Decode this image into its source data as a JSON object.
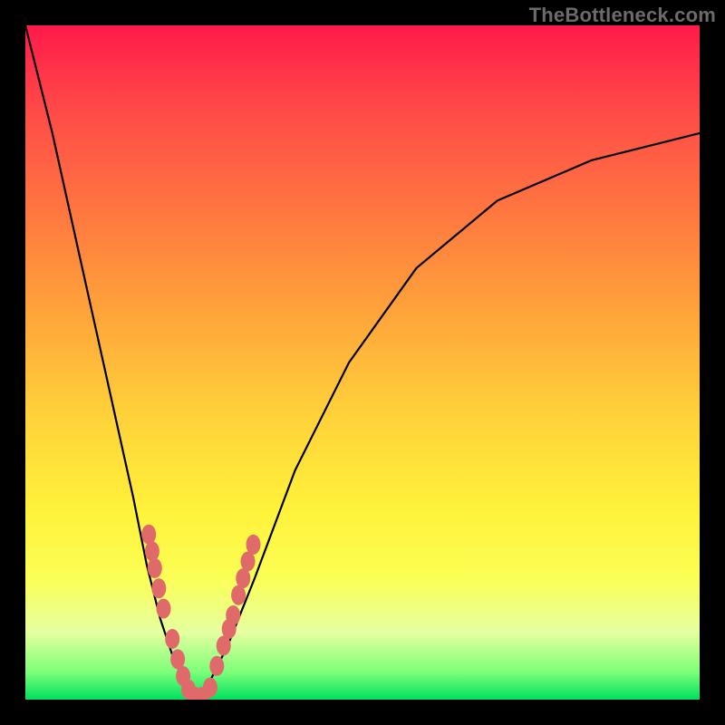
{
  "watermark": "TheBottleneck.com",
  "chart_data": {
    "type": "line",
    "title": "",
    "xlabel": "",
    "ylabel": "",
    "xlim": [
      0,
      100
    ],
    "ylim": [
      0,
      100
    ],
    "grid": false,
    "series": [
      {
        "name": "bottleneck-curve",
        "x": [
          0,
          4,
          8,
          12,
          16,
          18,
          20,
          22,
          24,
          25.5,
          27,
          30,
          34,
          40,
          48,
          58,
          70,
          84,
          100
        ],
        "y": [
          100,
          84,
          66,
          48,
          30,
          20,
          12,
          6,
          2,
          0,
          2,
          8,
          18,
          34,
          50,
          64,
          74,
          80,
          84
        ]
      }
    ],
    "markers": {
      "name": "highlight-beads",
      "points": [
        {
          "x": 18.3,
          "y": 24.5
        },
        {
          "x": 18.8,
          "y": 22.0
        },
        {
          "x": 19.2,
          "y": 19.5
        },
        {
          "x": 19.8,
          "y": 16.5
        },
        {
          "x": 20.5,
          "y": 13.5
        },
        {
          "x": 21.8,
          "y": 9.0
        },
        {
          "x": 22.6,
          "y": 6.0
        },
        {
          "x": 23.4,
          "y": 3.5
        },
        {
          "x": 24.2,
          "y": 1.5
        },
        {
          "x": 25.2,
          "y": 0.4
        },
        {
          "x": 26.2,
          "y": 0.4
        },
        {
          "x": 27.4,
          "y": 1.8
        },
        {
          "x": 28.4,
          "y": 5.0
        },
        {
          "x": 29.4,
          "y": 8.0
        },
        {
          "x": 30.2,
          "y": 10.5
        },
        {
          "x": 30.8,
          "y": 12.5
        },
        {
          "x": 31.6,
          "y": 15.5
        },
        {
          "x": 32.3,
          "y": 18.0
        },
        {
          "x": 33.0,
          "y": 20.5
        },
        {
          "x": 33.8,
          "y": 23.0
        }
      ]
    },
    "background_gradient": {
      "orientation": "vertical",
      "stops": [
        {
          "pos": 0.0,
          "color": "#ff1a4a"
        },
        {
          "pos": 0.28,
          "color": "#ff7840"
        },
        {
          "pos": 0.58,
          "color": "#ffd23a"
        },
        {
          "pos": 0.82,
          "color": "#fbff55"
        },
        {
          "pos": 1.0,
          "color": "#00e060"
        }
      ]
    }
  }
}
